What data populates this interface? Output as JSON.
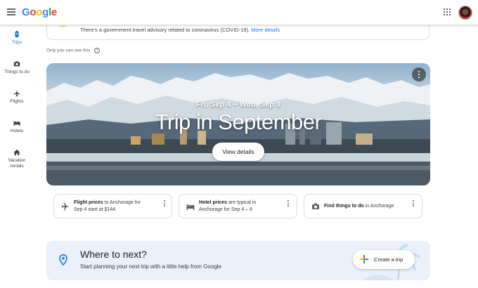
{
  "header": {
    "logo": [
      "G",
      "o",
      "o",
      "g",
      "l",
      "e"
    ],
    "logo_colors": [
      "#4285F4",
      "#EA4335",
      "#FBBC05",
      "#4285F4",
      "#34A853",
      "#EA4335"
    ]
  },
  "sidebar": {
    "items": [
      {
        "label": "Trips",
        "icon": "suitcase-icon",
        "active": true
      },
      {
        "label": "Things to do",
        "icon": "camera-icon"
      },
      {
        "label": "Flights",
        "icon": "airplane-icon"
      },
      {
        "label": "Hotels",
        "icon": "bed-icon"
      },
      {
        "label": "Vacation rentals",
        "label_lines": [
          "Vacation",
          "rentals"
        ],
        "icon": "house-icon"
      }
    ]
  },
  "advisory": {
    "text": "There's a government travel advisory related to coronavirus (COVID-19).",
    "link": "More details"
  },
  "only_you": "Only you can see this",
  "hero": {
    "dates": "Fri, Sep 4 – Wed, Sep 9",
    "title": "Trip in September",
    "button": "View details"
  },
  "cards": [
    {
      "bold": "Flight prices",
      "rest1": " to Anchorage for",
      "line2": "Sep 4 start at $144",
      "icon": "airplane-icon"
    },
    {
      "bold": "Hotel prices",
      "rest1": " are typical in",
      "line2": "Anchorage for Sep 4 – 8",
      "icon": "bed-icon"
    },
    {
      "bold": "Find things to do",
      "rest1": " in Anchorage",
      "line2": "",
      "icon": "camera-icon"
    }
  ],
  "next": {
    "title": "Where to next?",
    "subtitle": "Start planning your next trip with a little help from Google",
    "button": "Create a trip"
  },
  "colors": {
    "accent": "#1a73e8",
    "text": "#202124",
    "muted": "#5f6368",
    "border": "#dadce0",
    "panel": "#eaf1fb"
  }
}
